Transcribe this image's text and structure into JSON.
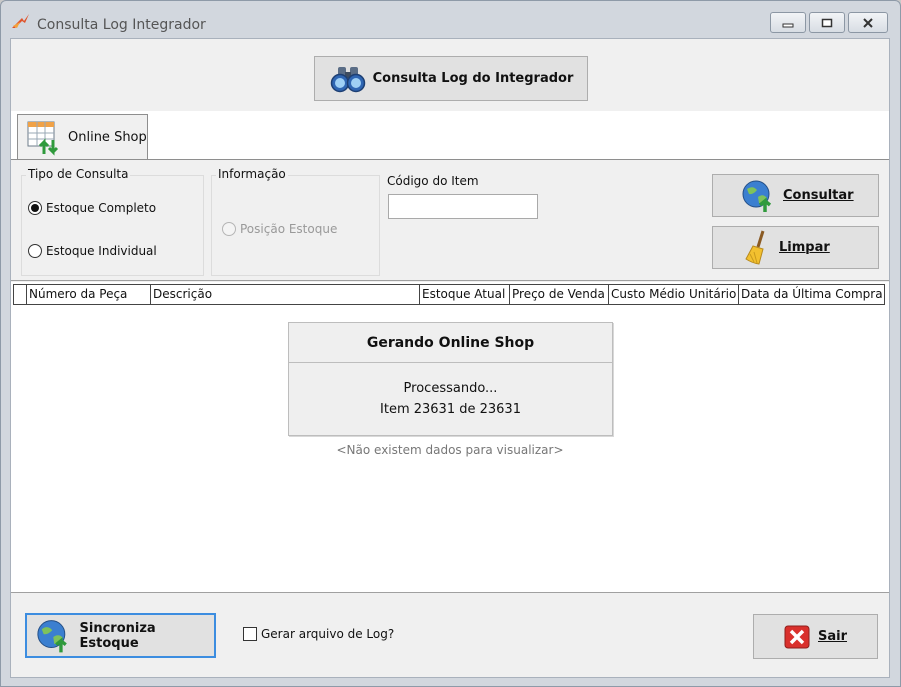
{
  "window": {
    "title": "Consulta Log Integrador"
  },
  "toolbar": {
    "consulta_log_label": "Consulta Log do Integrador"
  },
  "tabs": [
    {
      "label": "Online Shop",
      "icon": "spreadsheet-arrows-icon"
    }
  ],
  "filters": {
    "tipo_consulta": {
      "title": "Tipo de Consulta",
      "options": [
        "Estoque Completo",
        "Estoque Individual"
      ],
      "selected": "Estoque Completo"
    },
    "informacao": {
      "title": "Informação",
      "options": [
        "Posição Estoque"
      ]
    },
    "codigo_item": {
      "label": "Código do Item",
      "value": ""
    },
    "consultar_label": "Consultar",
    "limpar_label": "Limpar"
  },
  "grid": {
    "columns": [
      "Número da Peça",
      "Descrição",
      "Estoque Atual",
      "Preço de Venda",
      "Custo Médio Unitário",
      "Data da Última Compra"
    ],
    "empty_message": "<Não existem dados para visualizar>"
  },
  "progress": {
    "title": "Gerando Online Shop",
    "status": "Processando...",
    "count": "Item 23631 de 23631"
  },
  "footer": {
    "sincroniza_label": "Sincroniza Estoque",
    "gerar_log_label": "Gerar arquivo de Log?",
    "gerar_log_checked": false,
    "sair_label": "Sair"
  },
  "colors": {
    "focus_border": "#3c8de0",
    "close_red": "#d9302c"
  }
}
